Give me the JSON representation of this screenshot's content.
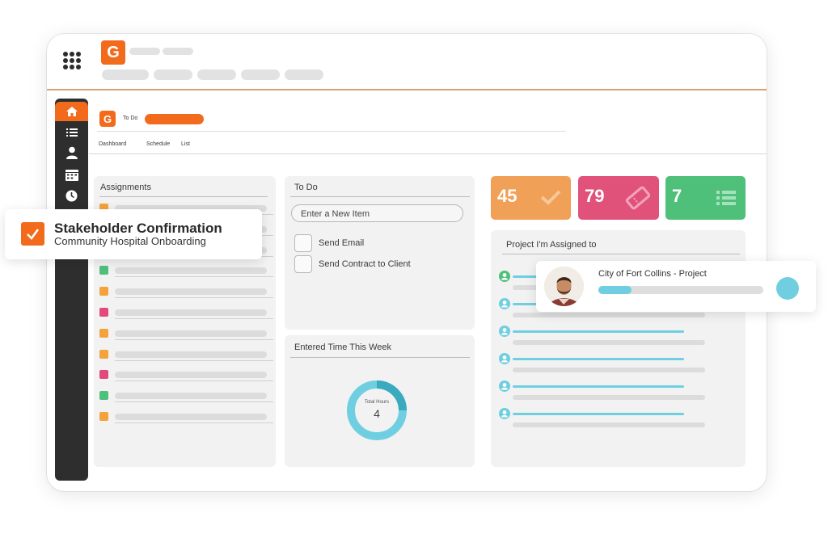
{
  "header": {
    "logo_letter": "G",
    "apps_icon": "grid-icon"
  },
  "subheader": {
    "logo_letter": "G",
    "breadcrumb": "To Do",
    "tabs": [
      {
        "label": "Dashboard"
      },
      {
        "label": "Schedule"
      },
      {
        "label": "List"
      }
    ]
  },
  "sidebar": {
    "items": [
      {
        "icon": "home-icon"
      },
      {
        "icon": "list-icon"
      },
      {
        "icon": "user-icon"
      },
      {
        "icon": "calendar-icon"
      },
      {
        "icon": "clock-icon"
      }
    ]
  },
  "assignments": {
    "title": "Assignments",
    "rows": [
      {
        "color": "#f4a23b"
      },
      {
        "color": "#f4a23b"
      },
      {
        "color": "#f4a23b"
      },
      {
        "color": "#4fc07a"
      },
      {
        "color": "#f4a23b"
      },
      {
        "color": "#e2487a"
      },
      {
        "color": "#f4a23b"
      },
      {
        "color": "#f4a23b"
      },
      {
        "color": "#e2487a"
      },
      {
        "color": "#4fc07a"
      },
      {
        "color": "#f4a23b"
      }
    ]
  },
  "todo": {
    "title": "To Do",
    "new_item_placeholder": "Enter a New Item",
    "items": [
      {
        "label": "Send Email"
      },
      {
        "label": "Send Contract to Client"
      }
    ]
  },
  "time": {
    "title": "Entered Time This Week",
    "donut_label": "Total Hours",
    "donut_value": "4"
  },
  "stats": [
    {
      "value": "45",
      "color": "#f1a057",
      "icon": "check-icon"
    },
    {
      "value": "79",
      "color": "#e0527a",
      "icon": "ticket-icon"
    },
    {
      "value": "7",
      "color": "#4fc07a",
      "icon": "list-icon"
    }
  ],
  "projects": {
    "title": "Project I'm Assigned to"
  },
  "toast": {
    "title": "Stakeholder Confirmation",
    "subtitle": "Community Hospital Onboarding"
  },
  "project_card": {
    "title": "City of Fort Collins - Project",
    "progress": 0.2
  },
  "colors": {
    "brand": "#f26a1b",
    "sidebar": "#2e2e2e",
    "accent_teal": "#6fcfe0"
  }
}
